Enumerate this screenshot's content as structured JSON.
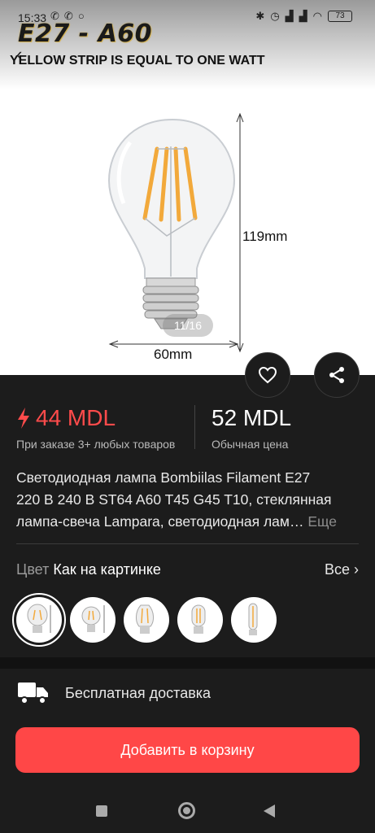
{
  "status_bar": {
    "time": "15:33",
    "battery": "73"
  },
  "hero": {
    "product_label": "E27 - A60",
    "strip_note": "YELLOW STRIP IS EQUAL TO ONE WATT",
    "height_label": "119mm",
    "width_label": "60mm",
    "counter": "11/16"
  },
  "price": {
    "promo_price": "44 MDL",
    "promo_note": "При заказе 3+ любых товаров",
    "regular_price": "52 MDL",
    "regular_note": "Обычная цена",
    "promo_color": "#ff4b4b"
  },
  "product": {
    "title_line1": "Светодиодная лампа Bombiilas Filament E27",
    "title_line2": "220 В 240 В ST64 A60 T45 G45 T10, стеклянная",
    "title_line3": "лампа-свеча Lampara, светодиодная лам…",
    "more": "Еще"
  },
  "color": {
    "label": "Цвет",
    "value": "Как на картинке",
    "all": "Все"
  },
  "delivery": {
    "text": "Бесплатная доставка"
  },
  "cart_button": {
    "label": "Добавить в корзину",
    "color": "#ff4747"
  }
}
